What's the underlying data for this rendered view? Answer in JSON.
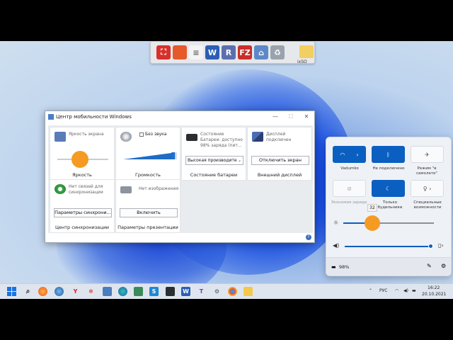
{
  "colors": {
    "accent": "#0a5fc0",
    "slider_knob": "#f59b23",
    "wallpaper_blue": "#2f59d8"
  },
  "top_toolbar": {
    "icons": [
      {
        "name": "screenshot-icon",
        "color": "#d9302c",
        "glyph": "⛶"
      },
      {
        "name": "paint-icon",
        "color": "#e45a2b",
        "glyph": ""
      },
      {
        "name": "document-icon",
        "color": "#f4f4f4",
        "glyph": "≡"
      },
      {
        "name": "word-icon",
        "color": "#2b5eb5",
        "glyph": "W"
      },
      {
        "name": "app-r-icon",
        "color": "#5b6fae",
        "glyph": "R"
      },
      {
        "name": "filezilla-icon",
        "color": "#c8302a",
        "glyph": "FZ"
      },
      {
        "name": "home-icon",
        "color": "#5d89c8",
        "glyph": "⌂"
      },
      {
        "name": "recycle-bin-icon",
        "color": "#9aa3ad",
        "glyph": "♻"
      }
    ],
    "desktop_folder_label": "ixSO"
  },
  "mobility": {
    "title": "Центр мобильности Windows",
    "brightness": {
      "header": "Яркость экрана",
      "caption": "Яркость",
      "level": 0.45
    },
    "volume": {
      "mute_label": "Без звука",
      "caption": "Громкость",
      "level": 0.95
    },
    "battery": {
      "header": "Состояние Батареи: доступно 98% заряда (пит...",
      "plan": "Высокая производите",
      "caption": "Состояние батареи"
    },
    "display": {
      "header": "Дисплей подключен",
      "button": "Отключить экран",
      "caption": "Внешний дисплей"
    },
    "sync": {
      "header": "Нет связей для синхронизации",
      "button": "Параметры синхрони...",
      "caption": "Центр синхронизации"
    },
    "presentation": {
      "header": "Нет изображения",
      "button": "Включить",
      "caption": "Параметры презентации"
    }
  },
  "quick_settings": {
    "wifi_label": "Vadumko",
    "bluetooth_label": "Не подключено",
    "airplane_label": "Режим \"в самолете\"",
    "battery_saver_label": "Экономия заряда",
    "focus_label": "Только будильники",
    "accessibility_label": "Специальные возможности",
    "brightness_value": "32",
    "brightness_level": 0.32,
    "volume_level": 0.98,
    "battery_text": "98%"
  },
  "taskbar": {
    "lang": "РУС",
    "time": "16:22",
    "date": "20.10.2021"
  }
}
